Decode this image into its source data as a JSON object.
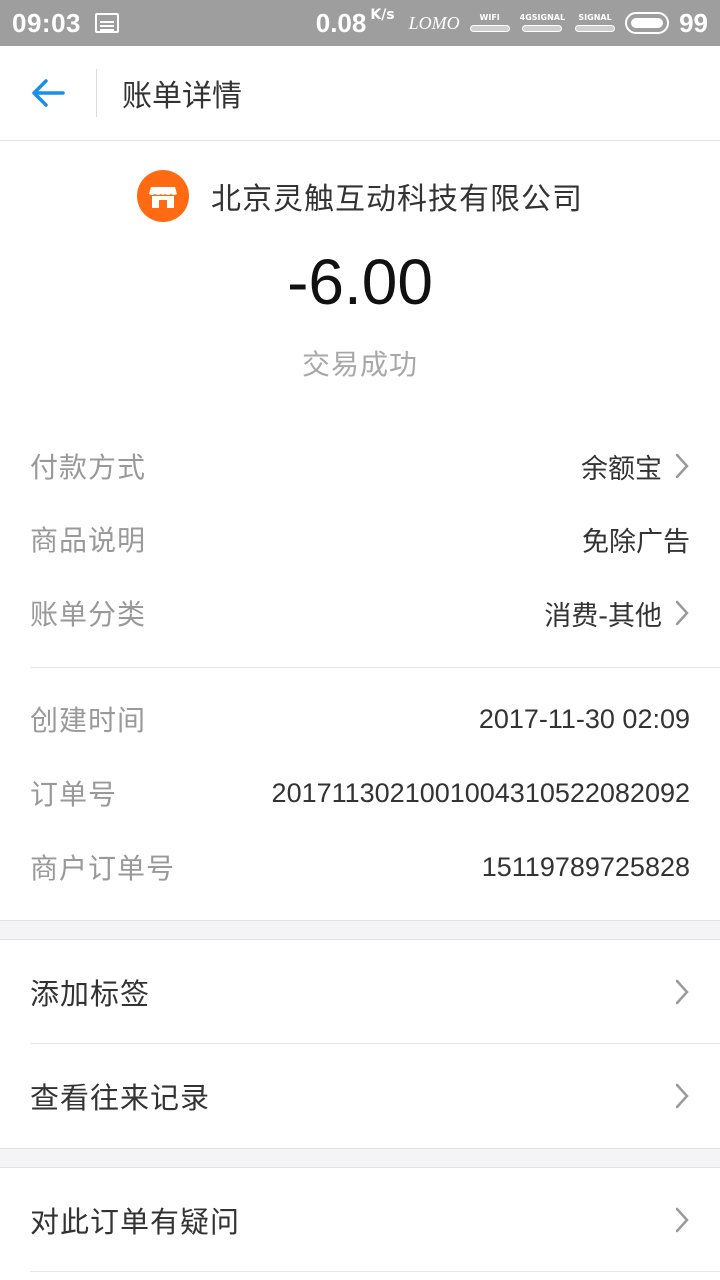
{
  "status_bar": {
    "time": "09:03",
    "speed": "0.08",
    "speed_unit": "K/s",
    "camera": "LOMO",
    "wifi_label": "WIFI",
    "signal_4g_label": "4GSIGNAL",
    "signal_label": "SIGNAL",
    "battery": "99"
  },
  "nav": {
    "title": "账单详情"
  },
  "header": {
    "merchant": "北京灵触互动科技有限公司",
    "amount": "-6.00",
    "status": "交易成功",
    "merchant_icon_color": "#ff6a13"
  },
  "details_top": [
    {
      "label": "付款方式",
      "value": "余额宝",
      "chevron": true
    },
    {
      "label": "商品说明",
      "value": "免除广告",
      "chevron": false
    },
    {
      "label": "账单分类",
      "value": "消费-其他",
      "chevron": true
    }
  ],
  "details_bottom": [
    {
      "label": "创建时间",
      "value": "2017-11-30 02:09"
    },
    {
      "label": "订单号",
      "value": "2017113021001004310522082092"
    },
    {
      "label": "商户订单号",
      "value": "15119789725828"
    }
  ],
  "actions": [
    {
      "label": "添加标签"
    },
    {
      "label": "查看往来记录"
    },
    {
      "label": "对此订单有疑问"
    }
  ],
  "colors": {
    "accent_blue": "#1a8ee8",
    "status_bar_bg": "#9e9e9e",
    "label_gray": "#999999"
  }
}
